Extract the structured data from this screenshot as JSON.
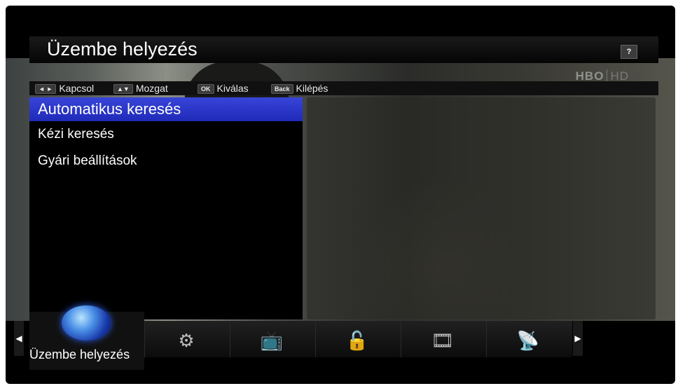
{
  "window": {
    "title": "Üzembe helyezés",
    "help_label": "?"
  },
  "channel_logo": {
    "brand": "HBO",
    "suffix": "HD"
  },
  "keybar": [
    {
      "key": "◄ ►",
      "label": "Kapcsol"
    },
    {
      "key": "▲▼",
      "label": "Mozgat"
    },
    {
      "key": "OK",
      "label": "Kiválas"
    },
    {
      "key": "Back",
      "label": "Kilépés"
    }
  ],
  "menu": {
    "items": [
      {
        "label": "Automatikus keresés",
        "selected": true
      },
      {
        "label": "Kézi keresés",
        "selected": false
      },
      {
        "label": "Gyári beállítások",
        "selected": false
      }
    ]
  },
  "bottom_nav": {
    "active_label": "Üzembe helyezés",
    "icons": [
      "globe-icon",
      "gear-icon",
      "tv-icon",
      "lock-icon",
      "media-icon",
      "satellite-icon"
    ]
  },
  "colors": {
    "selection": "#2433c8",
    "background": "#000000",
    "text": "#ffffff"
  }
}
